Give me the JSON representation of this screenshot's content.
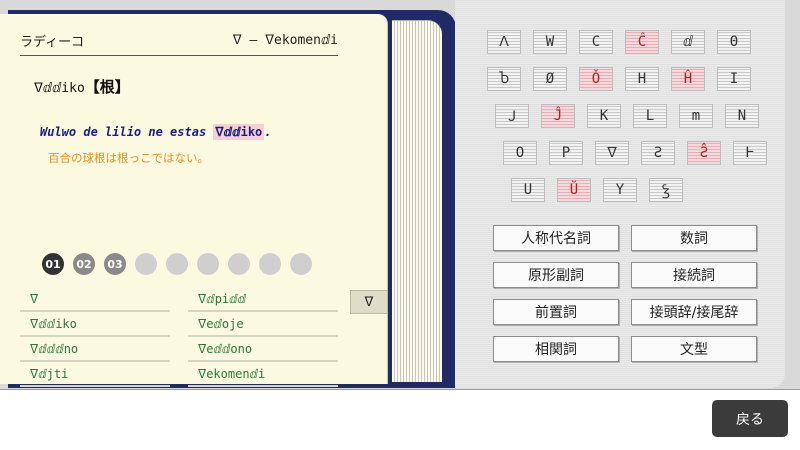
{
  "header": {
    "left": "ラディーコ",
    "right": "ᐁ — ᐁekomenⅆi"
  },
  "entry": {
    "word": "ᐁⅆⅆiko",
    "meaning": "【根】"
  },
  "example": {
    "sentence_before": "Wulwo de lilio ne estas ",
    "sentence_highlight": "ᐁⅆⅆiko",
    "sentence_after": ".",
    "translation": "百合の球根は根っこではない。"
  },
  "pager": {
    "pages": [
      "01",
      "02",
      "03",
      "",
      "",
      "",
      "",
      "",
      ""
    ]
  },
  "wordlist": {
    "col1": [
      "ᐁ",
      "ᐁⅆⅆiko",
      "ᐁⅆⅆⅆno",
      "ᐁⅆjti"
    ],
    "col2": [
      "ᐁⅆpiⅆⅆ",
      "ᐁeⅆoje",
      "ᐁeⅆⅆono",
      "ᐁekomenⅆi"
    ]
  },
  "letter_tab": "ᐁ",
  "keyboard": {
    "rows": [
      [
        {
          "k": "ᐱ",
          "hi": false
        },
        {
          "k": "W",
          "hi": false
        },
        {
          "k": "C",
          "hi": false
        },
        {
          "k": "Ĉ",
          "hi": true
        },
        {
          "k": "ⅆ",
          "hi": false
        },
        {
          "k": "Θ",
          "hi": false
        }
      ],
      [
        {
          "k": "Ⴆ",
          "hi": false
        },
        {
          "k": "Ø",
          "hi": false
        },
        {
          "k": "Ǒ",
          "hi": true
        },
        {
          "k": "H",
          "hi": false
        },
        {
          "k": "Ĥ",
          "hi": true
        },
        {
          "k": "I",
          "hi": false
        }
      ],
      [
        {
          "k": "Ｊ",
          "hi": false
        },
        {
          "k": "Ĵ",
          "hi": true
        },
        {
          "k": "K",
          "hi": false
        },
        {
          "k": "L",
          "hi": false
        },
        {
          "k": "m",
          "hi": false
        },
        {
          "k": "N",
          "hi": false
        }
      ],
      [
        {
          "k": "O",
          "hi": false
        },
        {
          "k": "P",
          "hi": false
        },
        {
          "k": "ᐁ",
          "hi": false
        },
        {
          "k": "Ƨ",
          "hi": false
        },
        {
          "k": "Ƨ̂",
          "hi": true
        },
        {
          "k": "Ⱶ",
          "hi": false
        }
      ],
      [
        {
          "k": "U",
          "hi": false
        },
        {
          "k": "Ŭ",
          "hi": true
        },
        {
          "k": "Y",
          "hi": false
        },
        {
          "k": "Ꝣ",
          "hi": false
        }
      ]
    ]
  },
  "pos_buttons": [
    [
      "人称代名詞",
      "数詞"
    ],
    [
      "原形副詞",
      "接続詞"
    ],
    [
      "前置詞",
      "接頭辞/接尾辞"
    ],
    [
      "相関詞",
      "文型"
    ]
  ],
  "back_label": "戻る",
  "colors": {
    "cover": "#1f2a66",
    "highlight": "#f6cfd4",
    "translation": "#e8901d",
    "example": "#1a1d88"
  }
}
